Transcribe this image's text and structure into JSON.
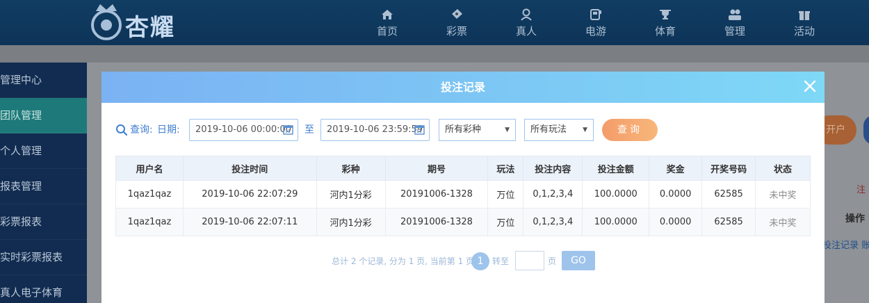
{
  "brand": {
    "logo_text": "杏耀"
  },
  "nav": [
    {
      "label": "首页",
      "icon": "home-icon"
    },
    {
      "label": "彩票",
      "icon": "ticket-icon"
    },
    {
      "label": "真人",
      "icon": "person-icon"
    },
    {
      "label": "电游",
      "icon": "game-icon"
    },
    {
      "label": "体育",
      "icon": "trophy-icon"
    },
    {
      "label": "管理",
      "icon": "users-icon"
    },
    {
      "label": "活动",
      "icon": "gift-icon"
    }
  ],
  "sidebar": {
    "items": [
      {
        "label": "管理中心"
      },
      {
        "label": "团队管理",
        "active": true
      },
      {
        "label": "个人管理"
      },
      {
        "label": "报表管理"
      },
      {
        "label": "彩票报表"
      },
      {
        "label": "实时彩票报表"
      },
      {
        "label": "真人电子体育"
      }
    ]
  },
  "background": {
    "btn_open": "开户",
    "label_note": "注",
    "col_action": "操作",
    "links": "投注记录 账变"
  },
  "modal": {
    "title": "投注记录",
    "filters": {
      "query_label": "查询:",
      "date_label": "日期:",
      "start_date": "2019-10-06 00:00:00",
      "to_label": "至",
      "end_date": "2019-10-06 23:59:59",
      "lottery_select": "所有彩种",
      "play_select": "所有玩法",
      "query_button": "查询"
    },
    "table": {
      "headers": [
        "用户名",
        "投注时间",
        "彩种",
        "期号",
        "玩法",
        "投注内容",
        "投注金额",
        "奖金",
        "开奖号码",
        "状态"
      ],
      "rows": [
        [
          "1qaz1qaz",
          "2019-10-06 22:07:29",
          "河内1分彩",
          "20191006-1328",
          "万位",
          "0,1,2,3,4",
          "100.0000",
          "0.0000",
          "62585",
          "未中奖"
        ],
        [
          "1qaz1qaz",
          "2019-10-06 22:07:11",
          "河内1分彩",
          "20191006-1328",
          "万位",
          "0,1,2,3,4",
          "100.0000",
          "0.0000",
          "62585",
          "未中奖"
        ]
      ]
    },
    "pager": {
      "summary": "总计 2 个记录, 分为 1 页, 当前第 1 页",
      "current_page": "1",
      "goto_label": "转至",
      "page_suffix": "页",
      "go_button": "GO"
    }
  },
  "colors": {
    "accent": "#7bb2f3",
    "query_button": "#f49c6a"
  }
}
